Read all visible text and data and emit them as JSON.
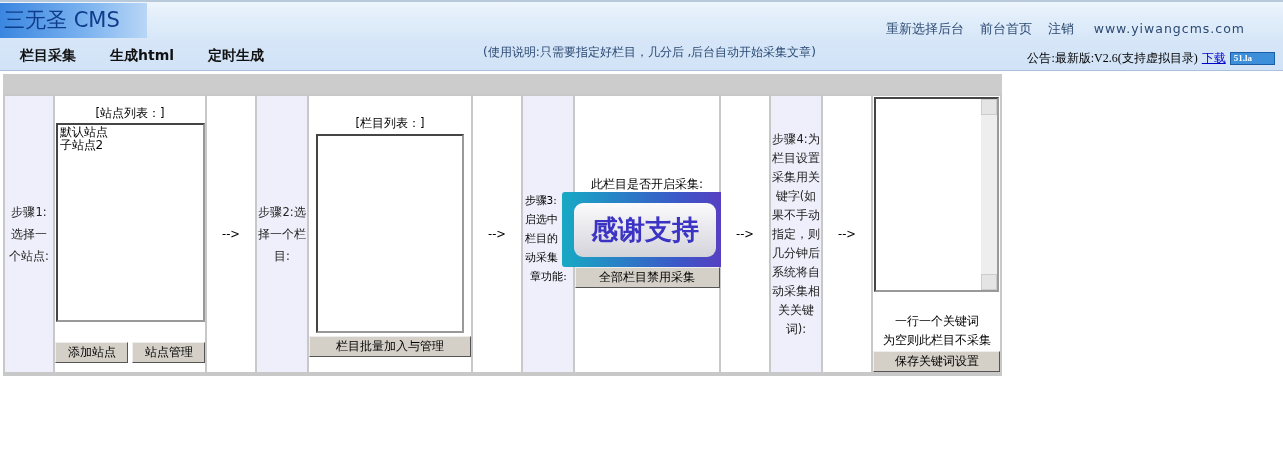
{
  "header": {
    "logo": "三无圣 CMS",
    "nav": [
      {
        "label": "栏目采集"
      },
      {
        "label": "生成html"
      },
      {
        "label": "定时生成"
      }
    ],
    "usage": "(使用说明:只需要指定好栏目，几分后 ,后台自动开始采集文章)",
    "links": [
      "重新选择后台",
      "前台首页",
      "注销",
      "www.yiwangcms.com"
    ],
    "notice": "公告:最新版:V2.6(支持虚拟目录)",
    "notice_link": "下载",
    "counter_badge": "51.la"
  },
  "step1": {
    "label": "步骤1:选择一个站点:",
    "list_title": "[站点列表：]",
    "sites": [
      {
        "label": "默认站点",
        "selected": false
      },
      {
        "label": "子站点2",
        "selected": false
      }
    ],
    "buttons": [
      "添加站点",
      "站点管理"
    ]
  },
  "arrows": [
    "-->",
    "-->",
    "-->",
    "-->"
  ],
  "step2": {
    "label": "步骤2:选择一个栏目:",
    "list_title": "[栏目列表：]",
    "button": "栏目批量加入与管理"
  },
  "step3": {
    "label_lines": [
      "步骤3:",
      "启选中",
      "栏目的",
      "动采集",
      "章功能:"
    ],
    "question": "此栏目是否开启采集:",
    "button": "全部栏目禁用采集"
  },
  "overlay": {
    "text": "感谢支持"
  },
  "step4": {
    "label": "步骤4:为栏目设置采集用关键字(如果不手动指定，则几分钟后系统将自动采集相关关键词):",
    "hint_lines": [
      "一行一个关键词",
      "为空则此栏目不采集"
    ],
    "button": "保存关键词设置"
  }
}
